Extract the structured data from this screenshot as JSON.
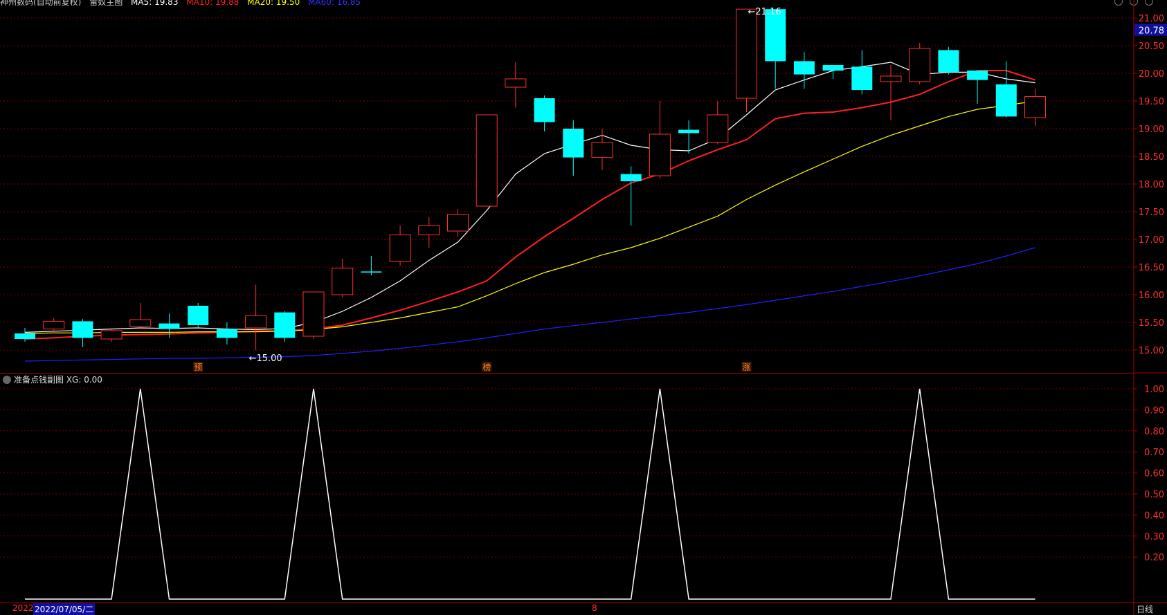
{
  "header": {
    "items": [
      "神州数码(自动前复权)",
      "雷奴主图",
      "MA5: 19.83",
      "MA10: 19.88",
      "MA20: 19.50",
      "MA60: 16.85"
    ],
    "colors": [
      "#cccccc",
      "#cccccc",
      "#ffffff",
      "#ff2020",
      "#ffff00",
      "#3030ff"
    ]
  },
  "price_badge": "20.78",
  "sub_panel_title": "准备点钱副图  XG: 0.00",
  "status": {
    "date_prefix": "2022",
    "date_box": "2022/07/05/二",
    "mid_mark": "8",
    "period": "日线"
  },
  "colors": {
    "up": "#ff3030",
    "down": "#00ffff",
    "grid": "#7a0000",
    "axis_text": "#ff3030",
    "ma5": "#ffffff",
    "ma10": "#ff2020",
    "ma20": "#ffff00",
    "ma60": "#2020ff",
    "xg": "#ffffff"
  },
  "chart_data": [
    {
      "type": "candlestick",
      "ylim": [
        14.65,
        21.2
      ],
      "yticks": [
        15.0,
        15.5,
        16.0,
        16.5,
        17.0,
        17.5,
        18.0,
        18.5,
        19.0,
        19.5,
        20.0,
        20.5,
        21.0
      ],
      "ytick_labels": [
        "15.00",
        "15.50",
        "16.00",
        "16.50",
        "17.00",
        "17.50",
        "18.00",
        "18.50",
        "19.00",
        "19.50",
        "20.00",
        "20.50",
        "21.00"
      ],
      "candles": [
        {
          "o": 15.3,
          "c": 15.2,
          "h": 15.4,
          "l": 15.15
        },
        {
          "o": 15.38,
          "c": 15.52,
          "h": 15.58,
          "l": 15.3
        },
        {
          "o": 15.52,
          "c": 15.22,
          "h": 15.56,
          "l": 15.05
        },
        {
          "o": 15.2,
          "c": 15.35,
          "h": 15.4,
          "l": 15.15
        },
        {
          "o": 15.43,
          "c": 15.55,
          "h": 15.85,
          "l": 15.38
        },
        {
          "o": 15.48,
          "c": 15.38,
          "h": 15.66,
          "l": 15.22
        },
        {
          "o": 15.8,
          "c": 15.45,
          "h": 15.85,
          "l": 15.4
        },
        {
          "o": 15.38,
          "c": 15.22,
          "h": 15.5,
          "l": 15.1
        },
        {
          "o": 15.4,
          "c": 15.62,
          "h": 16.18,
          "l": 15.0
        },
        {
          "o": 15.68,
          "c": 15.22,
          "h": 15.7,
          "l": 15.15
        },
        {
          "o": 15.25,
          "c": 16.05,
          "h": 16.05,
          "l": 15.2
        },
        {
          "o": 16.0,
          "c": 16.48,
          "h": 16.65,
          "l": 15.95
        },
        {
          "o": 16.42,
          "c": 16.4,
          "h": 16.7,
          "l": 16.35
        },
        {
          "o": 16.6,
          "c": 17.08,
          "h": 17.25,
          "l": 16.52
        },
        {
          "o": 17.08,
          "c": 17.25,
          "h": 17.4,
          "l": 16.85
        },
        {
          "o": 17.15,
          "c": 17.45,
          "h": 17.55,
          "l": 17.05
        },
        {
          "o": 17.6,
          "c": 19.25,
          "h": 19.25,
          "l": 17.6
        },
        {
          "o": 19.75,
          "c": 19.9,
          "h": 20.2,
          "l": 19.38
        },
        {
          "o": 19.55,
          "c": 19.12,
          "h": 19.6,
          "l": 18.95
        },
        {
          "o": 19.0,
          "c": 18.48,
          "h": 19.15,
          "l": 18.15
        },
        {
          "o": 18.48,
          "c": 18.75,
          "h": 19.0,
          "l": 18.25
        },
        {
          "o": 18.18,
          "c": 18.05,
          "h": 18.32,
          "l": 17.25
        },
        {
          "o": 18.15,
          "c": 18.9,
          "h": 19.5,
          "l": 18.1
        },
        {
          "o": 18.98,
          "c": 18.92,
          "h": 19.15,
          "l": 18.55
        },
        {
          "o": 18.75,
          "c": 19.25,
          "h": 19.5,
          "l": 18.72
        },
        {
          "o": 19.55,
          "c": 21.16,
          "h": 21.16,
          "l": 19.3
        },
        {
          "o": 21.16,
          "c": 20.22,
          "h": 21.16,
          "l": 19.72
        },
        {
          "o": 20.22,
          "c": 19.98,
          "h": 20.38,
          "l": 19.72
        },
        {
          "o": 20.15,
          "c": 20.05,
          "h": 20.15,
          "l": 19.9
        },
        {
          "o": 20.12,
          "c": 19.7,
          "h": 20.42,
          "l": 19.62
        },
        {
          "o": 19.85,
          "c": 19.95,
          "h": 20.15,
          "l": 19.15
        },
        {
          "o": 19.85,
          "c": 20.45,
          "h": 20.55,
          "l": 19.8
        },
        {
          "o": 20.42,
          "c": 20.02,
          "h": 20.48,
          "l": 19.98
        },
        {
          "o": 20.05,
          "c": 19.88,
          "h": 20.05,
          "l": 19.45
        },
        {
          "o": 19.8,
          "c": 19.22,
          "h": 20.22,
          "l": 19.2
        },
        {
          "o": 19.2,
          "c": 19.58,
          "h": 19.72,
          "l": 19.05
        }
      ],
      "series": [
        {
          "key": "ma5",
          "values": [
            15.32,
            15.34,
            15.36,
            15.38,
            15.4,
            15.39,
            15.4,
            15.38,
            15.37,
            15.39,
            15.5,
            15.7,
            15.95,
            16.25,
            16.62,
            16.95,
            17.52,
            18.18,
            18.55,
            18.72,
            18.88,
            18.7,
            18.62,
            18.6,
            18.82,
            19.25,
            19.7,
            19.88,
            20.05,
            20.12,
            20.2,
            19.98,
            20.02,
            20.02,
            19.9,
            19.83
          ]
        },
        {
          "key": "ma10",
          "values": [
            15.2,
            15.22,
            15.25,
            15.27,
            15.28,
            15.29,
            15.31,
            15.32,
            15.34,
            15.35,
            15.38,
            15.45,
            15.58,
            15.72,
            15.88,
            16.05,
            16.25,
            16.68,
            17.05,
            17.38,
            17.72,
            18.02,
            18.18,
            18.42,
            18.62,
            18.8,
            19.18,
            19.28,
            19.3,
            19.38,
            19.48,
            19.62,
            19.85,
            20.05,
            20.05,
            19.88
          ]
        },
        {
          "key": "ma20",
          "values": [
            15.3,
            15.31,
            15.31,
            15.32,
            15.32,
            15.32,
            15.33,
            15.33,
            15.33,
            15.34,
            15.37,
            15.42,
            15.5,
            15.58,
            15.68,
            15.78,
            15.98,
            16.2,
            16.4,
            16.55,
            16.72,
            16.85,
            17.02,
            17.22,
            17.42,
            17.72,
            17.98,
            18.22,
            18.45,
            18.68,
            18.88,
            19.05,
            19.22,
            19.35,
            19.42,
            19.5
          ]
        },
        {
          "key": "ma60",
          "values": [
            14.8,
            14.81,
            14.82,
            14.83,
            14.84,
            14.85,
            14.85,
            14.86,
            14.87,
            14.88,
            14.9,
            14.94,
            14.98,
            15.03,
            15.09,
            15.15,
            15.22,
            15.3,
            15.38,
            15.44,
            15.5,
            15.56,
            15.62,
            15.68,
            15.75,
            15.82,
            15.9,
            15.98,
            16.06,
            16.15,
            16.24,
            16.34,
            16.45,
            16.56,
            16.7,
            16.85
          ]
        }
      ],
      "annotations": [
        {
          "label": "←15.00",
          "candle": 8,
          "value": 15.0
        },
        {
          "label": "←21.16",
          "candle": 25,
          "value": 21.16
        }
      ],
      "markers": [
        {
          "label": "预",
          "candle": 6
        },
        {
          "label": "榜",
          "candle": 16
        },
        {
          "label": "涨",
          "candle": 25
        }
      ]
    },
    {
      "type": "line",
      "name": "XG",
      "ylim": [
        0,
        1.05
      ],
      "yticks": [
        0.2,
        0.3,
        0.4,
        0.5,
        0.6,
        0.7,
        0.8,
        0.9,
        1.0
      ],
      "ytick_labels": [
        "0.20",
        "0.30",
        "0.40",
        "0.50",
        "0.60",
        "0.70",
        "0.80",
        "0.90",
        "1.00"
      ],
      "values": [
        0,
        0,
        0,
        0,
        1,
        0,
        0,
        0,
        0,
        0,
        1,
        0,
        0,
        0,
        0,
        0,
        0,
        0,
        0,
        0,
        0,
        0,
        1,
        0,
        0,
        0,
        0,
        0,
        0,
        0,
        0,
        1,
        0,
        0,
        0,
        0
      ]
    }
  ]
}
